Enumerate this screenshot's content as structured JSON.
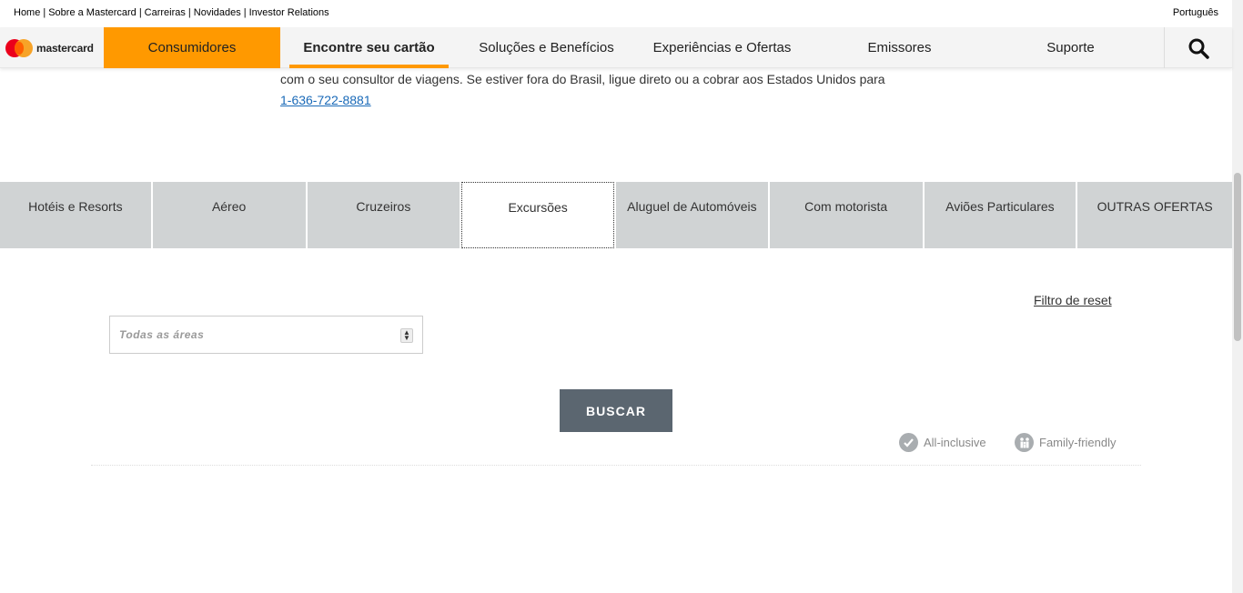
{
  "utility_links": [
    "Home",
    "Sobre a Mastercard",
    "Carreiras",
    "Novidades",
    "Investor Relations"
  ],
  "language": "Português",
  "logo_text": "mastercard",
  "nav": {
    "consumidores": "Consumidores",
    "encontre": "Encontre seu cartão",
    "solucoes": "Soluções e Benefícios",
    "experiencias": "Experiências e Ofertas",
    "emissores": "Emissores",
    "suporte": "Suporte"
  },
  "intro": {
    "text": "com o seu consultor de viagens. Se estiver fora do Brasil, ligue direto ou a cobrar aos Estados Unidos para",
    "phone": "1-636-722-8881"
  },
  "tabs": [
    {
      "label": "Hotéis e Resorts",
      "active": false
    },
    {
      "label": "Aéreo",
      "active": false
    },
    {
      "label": "Cruzeiros",
      "active": false
    },
    {
      "label": "Excursões",
      "active": true
    },
    {
      "label": "Aluguel de Automóveis",
      "active": false
    },
    {
      "label": "Com motorista",
      "active": false
    },
    {
      "label": "Aviões Particulares",
      "active": false
    },
    {
      "label": "OUTRAS OFERTAS",
      "active": false
    }
  ],
  "filter": {
    "reset_label": "Filtro de reset",
    "area_placeholder": "Todas as áreas",
    "search_label": "BUSCAR"
  },
  "legend": {
    "all_inclusive": "All-inclusive",
    "family_friendly": "Family-friendly"
  },
  "colors": {
    "accent": "#ff9900",
    "button": "#5b6670",
    "tab_bg": "#d0d3d4"
  }
}
